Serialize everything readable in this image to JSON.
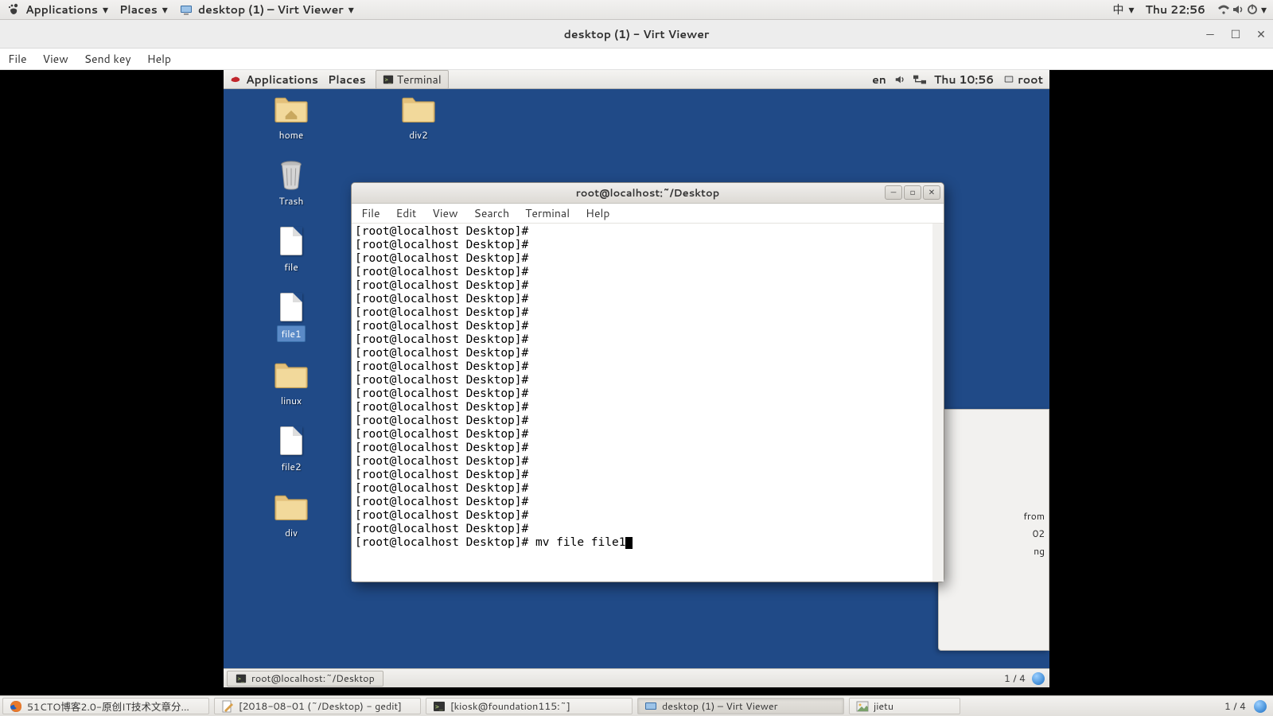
{
  "host_topbar": {
    "applications": "Applications",
    "places": "Places",
    "active_app": "desktop (1) – Virt Viewer",
    "ime": "中",
    "clock": "Thu 22:56"
  },
  "virt_window": {
    "title": "desktop (1) - Virt Viewer",
    "menu": {
      "file": "File",
      "view": "View",
      "sendkey": "Send key",
      "help": "Help"
    }
  },
  "guest_topbar": {
    "applications": "Applications",
    "places": "Places",
    "terminal_btn": "Terminal",
    "lang": "en",
    "clock": "Thu 10:56",
    "user": "root"
  },
  "desktop_icons": {
    "home": "home",
    "div2": "div2",
    "trash": "Trash",
    "file": "file",
    "file1": "file1",
    "linux": "linux",
    "file2": "file2",
    "div": "div"
  },
  "terminal": {
    "title": "root@localhost:~/Desktop",
    "menu": {
      "file": "File",
      "edit": "Edit",
      "view": "View",
      "search": "Search",
      "terminal": "Terminal",
      "help": "Help"
    },
    "prompt": "[root@localhost Desktop]#",
    "blank_prompt_count": 23,
    "command": "mv file file1"
  },
  "peek_lines": [
    "from",
    "02",
    "ng"
  ],
  "guest_btmbar": {
    "task": "root@localhost:~/Desktop",
    "workspace": "1 / 4"
  },
  "host_btmbar": {
    "tasks": [
      "51CTO博客2.0-原创IT技术文章分...",
      "[2018-08-01 (~/Desktop) - gedit]",
      "[kiosk@foundation115:~]",
      "desktop (1) – Virt Viewer",
      "jietu"
    ],
    "workspace": "1 / 4"
  }
}
